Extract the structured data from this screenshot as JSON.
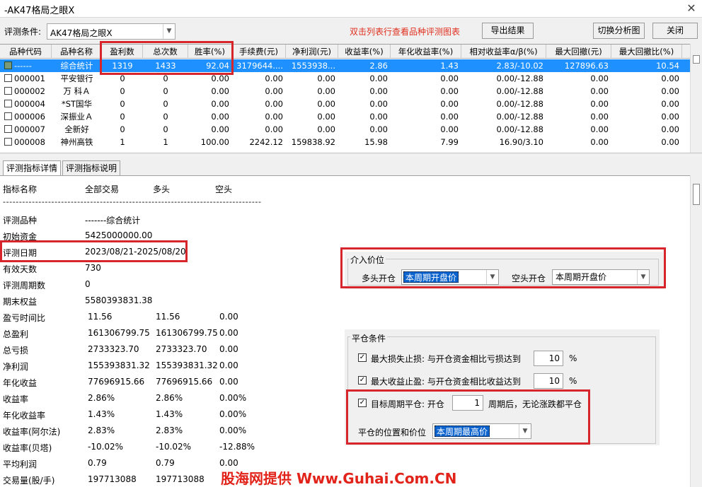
{
  "window": {
    "title": "-AK47格局之眼X",
    "close_glyph": "✕"
  },
  "toolbar": {
    "condition_label": "评测条件:",
    "condition_value": "AK47格局之眼X",
    "hint": "双击列表行查看品种评测图表",
    "export_label": "导出结果",
    "switch_label": "切换分析图",
    "close_label": "关闭"
  },
  "grid": {
    "headers": [
      "品种代码",
      "品种名称",
      "盈利数",
      "总次数",
      "胜率(%)",
      "手续费(元)",
      "净利润(元)",
      "收益率(%)",
      "年化收益率(%)",
      "相对收益率α/β(%)",
      "最大回撤(元)",
      "最大回撤比(%)"
    ],
    "rows": [
      [
        "------",
        "综合统计",
        "1319",
        "1433",
        "92.04",
        "3179644....",
        "1553938...",
        "2.86",
        "1.43",
        "2.83/-10.02",
        "127896.63",
        "10.54"
      ],
      [
        "000001",
        "平安银行",
        "0",
        "0",
        "0.00",
        "0.00",
        "0.00",
        "0.00",
        "0.00",
        "0.00/-12.88",
        "0.00",
        "0.00"
      ],
      [
        "000002",
        "万 科Ａ",
        "0",
        "0",
        "0.00",
        "0.00",
        "0.00",
        "0.00",
        "0.00",
        "0.00/-12.88",
        "0.00",
        "0.00"
      ],
      [
        "000004",
        "*ST国华",
        "0",
        "0",
        "0.00",
        "0.00",
        "0.00",
        "0.00",
        "0.00",
        "0.00/-12.88",
        "0.00",
        "0.00"
      ],
      [
        "000006",
        "深振业Ａ",
        "0",
        "0",
        "0.00",
        "0.00",
        "0.00",
        "0.00",
        "0.00",
        "0.00/-12.88",
        "0.00",
        "0.00"
      ],
      [
        "000007",
        "全新好",
        "0",
        "0",
        "0.00",
        "0.00",
        "0.00",
        "0.00",
        "0.00",
        "0.00/-12.88",
        "0.00",
        "0.00"
      ],
      [
        "000008",
        "神州高铁",
        "1",
        "1",
        "100.00",
        "2242.12",
        "159838.92",
        "15.98",
        "7.99",
        "16.90/3.10",
        "0.00",
        "0.00"
      ]
    ]
  },
  "tabs": {
    "details": "评测指标详情",
    "description": "评测指标说明"
  },
  "details": {
    "header": [
      "指标名称",
      "全部交易",
      "多头",
      "空头"
    ],
    "separator": "--------------------------------------------------------------------------------",
    "rows": [
      {
        "name": "评测品种",
        "all": "-------综合统计",
        "long": "",
        "short": ""
      },
      {
        "name": "初始资金",
        "all": "5425000000.00",
        "long": "",
        "short": ""
      },
      {
        "name": "评测日期",
        "all": "2023/08/21-2025/08/20",
        "long": "",
        "short": ""
      },
      {
        "name": "有效天数",
        "all": "730",
        "long": "",
        "short": ""
      },
      {
        "name": "评测周期数",
        "all": "0",
        "long": "",
        "short": ""
      },
      {
        "name": "期末权益",
        "all": "5580393831.38",
        "long": "",
        "short": ""
      },
      {
        "name": "盈亏时间比",
        "all": "11.56",
        "long": "11.56",
        "short": "0.00"
      },
      {
        "name": "总盈利",
        "all": "161306799.75",
        "long": "161306799.75",
        "short": "0.00"
      },
      {
        "name": "总亏损",
        "all": "2733323.70",
        "long": "2733323.70",
        "short": "0.00"
      },
      {
        "name": "净利润",
        "all": "155393831.32",
        "long": "155393831.32",
        "short": "0.00"
      },
      {
        "name": "年化收益",
        "all": "77696915.66",
        "long": "77696915.66",
        "short": "0.00"
      },
      {
        "name": "收益率",
        "all": "2.86%",
        "long": "2.86%",
        "short": "0.00%"
      },
      {
        "name": "年化收益率",
        "all": "1.43%",
        "long": "1.43%",
        "short": "0.00%"
      },
      {
        "name": "收益率(阿尔法)",
        "all": "2.83%",
        "long": "2.83%",
        "short": "0.00%"
      },
      {
        "name": "收益率(贝塔)",
        "all": "-10.02%",
        "long": "-10.02%",
        "short": "-12.88%"
      },
      {
        "name": "平均利润",
        "all": "0.79",
        "long": "0.79",
        "short": "0.00"
      },
      {
        "name": "交易量(股/手)",
        "all": "197713088",
        "long": "197713088",
        "short": ""
      }
    ]
  },
  "entry": {
    "title": "介入价位",
    "long_label": "多头开仓",
    "long_value": "本周期开盘价",
    "short_label": "空头开仓",
    "short_value": "本周期开盘价"
  },
  "close": {
    "title": "平仓条件",
    "stop_loss_label": "最大损失止损: 与开仓资金相比亏损达到",
    "stop_loss_value": "10",
    "take_profit_label": "最大收益止盈: 与开仓资金相比收益达到",
    "take_profit_value": "10",
    "percent": "%",
    "target_label": "目标周期平仓: 开仓",
    "target_value": "1",
    "target_suffix": "周期后，无论涨跌都平仓",
    "position_label": "平仓的位置和价位",
    "position_value": "本周期最高价",
    "check_glyph": "✓"
  },
  "watermark": "股海网提供 Www.Guhai.Com.CN",
  "colors": {
    "selection": "#1e90ff",
    "highlight_box": "#d7262b",
    "hint": "#e0301e"
  }
}
